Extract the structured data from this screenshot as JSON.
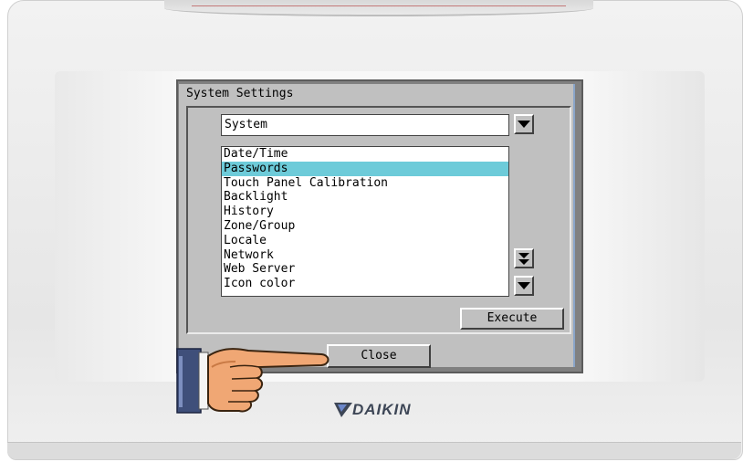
{
  "window": {
    "title": "System Settings"
  },
  "category": {
    "selected": "System"
  },
  "settings_list": {
    "items": [
      {
        "label": "Date/Time",
        "selected": false
      },
      {
        "label": "Passwords",
        "selected": true
      },
      {
        "label": "Touch Panel Calibration",
        "selected": false
      },
      {
        "label": "Backlight",
        "selected": false
      },
      {
        "label": "History",
        "selected": false
      },
      {
        "label": "Zone/Group",
        "selected": false
      },
      {
        "label": "Locale",
        "selected": false
      },
      {
        "label": "Network",
        "selected": false
      },
      {
        "label": "Web Server",
        "selected": false
      },
      {
        "label": "Icon color",
        "selected": false
      }
    ]
  },
  "buttons": {
    "execute": "Execute",
    "close": "Close"
  },
  "brand": {
    "name": "DAIKIN"
  },
  "colors": {
    "selection": "#6dcbd9",
    "screen_bg": "#c0c0c0",
    "brand": "#3d4656"
  },
  "icons": {
    "dropdown": "chevron-down-icon",
    "page_down": "double-chevron-down-icon",
    "scroll_down": "chevron-down-icon",
    "pointer": "pointing-hand-icon",
    "logo": "daikin-logo-icon"
  }
}
